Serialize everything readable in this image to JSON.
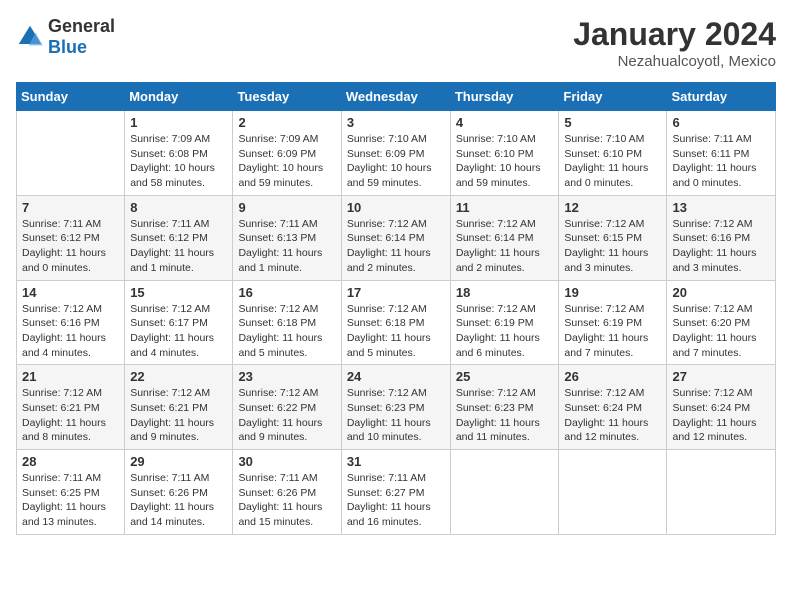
{
  "header": {
    "logo_general": "General",
    "logo_blue": "Blue",
    "month_year": "January 2024",
    "location": "Nezahualcoyotl, Mexico"
  },
  "weekdays": [
    "Sunday",
    "Monday",
    "Tuesday",
    "Wednesday",
    "Thursday",
    "Friday",
    "Saturday"
  ],
  "weeks": [
    [
      {
        "day": "",
        "sunrise": "",
        "sunset": "",
        "daylight": ""
      },
      {
        "day": "1",
        "sunrise": "Sunrise: 7:09 AM",
        "sunset": "Sunset: 6:08 PM",
        "daylight": "Daylight: 10 hours and 58 minutes."
      },
      {
        "day": "2",
        "sunrise": "Sunrise: 7:09 AM",
        "sunset": "Sunset: 6:09 PM",
        "daylight": "Daylight: 10 hours and 59 minutes."
      },
      {
        "day": "3",
        "sunrise": "Sunrise: 7:10 AM",
        "sunset": "Sunset: 6:09 PM",
        "daylight": "Daylight: 10 hours and 59 minutes."
      },
      {
        "day": "4",
        "sunrise": "Sunrise: 7:10 AM",
        "sunset": "Sunset: 6:10 PM",
        "daylight": "Daylight: 10 hours and 59 minutes."
      },
      {
        "day": "5",
        "sunrise": "Sunrise: 7:10 AM",
        "sunset": "Sunset: 6:10 PM",
        "daylight": "Daylight: 11 hours and 0 minutes."
      },
      {
        "day": "6",
        "sunrise": "Sunrise: 7:11 AM",
        "sunset": "Sunset: 6:11 PM",
        "daylight": "Daylight: 11 hours and 0 minutes."
      }
    ],
    [
      {
        "day": "7",
        "sunrise": "Sunrise: 7:11 AM",
        "sunset": "Sunset: 6:12 PM",
        "daylight": "Daylight: 11 hours and 0 minutes."
      },
      {
        "day": "8",
        "sunrise": "Sunrise: 7:11 AM",
        "sunset": "Sunset: 6:12 PM",
        "daylight": "Daylight: 11 hours and 1 minute."
      },
      {
        "day": "9",
        "sunrise": "Sunrise: 7:11 AM",
        "sunset": "Sunset: 6:13 PM",
        "daylight": "Daylight: 11 hours and 1 minute."
      },
      {
        "day": "10",
        "sunrise": "Sunrise: 7:12 AM",
        "sunset": "Sunset: 6:14 PM",
        "daylight": "Daylight: 11 hours and 2 minutes."
      },
      {
        "day": "11",
        "sunrise": "Sunrise: 7:12 AM",
        "sunset": "Sunset: 6:14 PM",
        "daylight": "Daylight: 11 hours and 2 minutes."
      },
      {
        "day": "12",
        "sunrise": "Sunrise: 7:12 AM",
        "sunset": "Sunset: 6:15 PM",
        "daylight": "Daylight: 11 hours and 3 minutes."
      },
      {
        "day": "13",
        "sunrise": "Sunrise: 7:12 AM",
        "sunset": "Sunset: 6:16 PM",
        "daylight": "Daylight: 11 hours and 3 minutes."
      }
    ],
    [
      {
        "day": "14",
        "sunrise": "Sunrise: 7:12 AM",
        "sunset": "Sunset: 6:16 PM",
        "daylight": "Daylight: 11 hours and 4 minutes."
      },
      {
        "day": "15",
        "sunrise": "Sunrise: 7:12 AM",
        "sunset": "Sunset: 6:17 PM",
        "daylight": "Daylight: 11 hours and 4 minutes."
      },
      {
        "day": "16",
        "sunrise": "Sunrise: 7:12 AM",
        "sunset": "Sunset: 6:18 PM",
        "daylight": "Daylight: 11 hours and 5 minutes."
      },
      {
        "day": "17",
        "sunrise": "Sunrise: 7:12 AM",
        "sunset": "Sunset: 6:18 PM",
        "daylight": "Daylight: 11 hours and 5 minutes."
      },
      {
        "day": "18",
        "sunrise": "Sunrise: 7:12 AM",
        "sunset": "Sunset: 6:19 PM",
        "daylight": "Daylight: 11 hours and 6 minutes."
      },
      {
        "day": "19",
        "sunrise": "Sunrise: 7:12 AM",
        "sunset": "Sunset: 6:19 PM",
        "daylight": "Daylight: 11 hours and 7 minutes."
      },
      {
        "day": "20",
        "sunrise": "Sunrise: 7:12 AM",
        "sunset": "Sunset: 6:20 PM",
        "daylight": "Daylight: 11 hours and 7 minutes."
      }
    ],
    [
      {
        "day": "21",
        "sunrise": "Sunrise: 7:12 AM",
        "sunset": "Sunset: 6:21 PM",
        "daylight": "Daylight: 11 hours and 8 minutes."
      },
      {
        "day": "22",
        "sunrise": "Sunrise: 7:12 AM",
        "sunset": "Sunset: 6:21 PM",
        "daylight": "Daylight: 11 hours and 9 minutes."
      },
      {
        "day": "23",
        "sunrise": "Sunrise: 7:12 AM",
        "sunset": "Sunset: 6:22 PM",
        "daylight": "Daylight: 11 hours and 9 minutes."
      },
      {
        "day": "24",
        "sunrise": "Sunrise: 7:12 AM",
        "sunset": "Sunset: 6:23 PM",
        "daylight": "Daylight: 11 hours and 10 minutes."
      },
      {
        "day": "25",
        "sunrise": "Sunrise: 7:12 AM",
        "sunset": "Sunset: 6:23 PM",
        "daylight": "Daylight: 11 hours and 11 minutes."
      },
      {
        "day": "26",
        "sunrise": "Sunrise: 7:12 AM",
        "sunset": "Sunset: 6:24 PM",
        "daylight": "Daylight: 11 hours and 12 minutes."
      },
      {
        "day": "27",
        "sunrise": "Sunrise: 7:12 AM",
        "sunset": "Sunset: 6:24 PM",
        "daylight": "Daylight: 11 hours and 12 minutes."
      }
    ],
    [
      {
        "day": "28",
        "sunrise": "Sunrise: 7:11 AM",
        "sunset": "Sunset: 6:25 PM",
        "daylight": "Daylight: 11 hours and 13 minutes."
      },
      {
        "day": "29",
        "sunrise": "Sunrise: 7:11 AM",
        "sunset": "Sunset: 6:26 PM",
        "daylight": "Daylight: 11 hours and 14 minutes."
      },
      {
        "day": "30",
        "sunrise": "Sunrise: 7:11 AM",
        "sunset": "Sunset: 6:26 PM",
        "daylight": "Daylight: 11 hours and 15 minutes."
      },
      {
        "day": "31",
        "sunrise": "Sunrise: 7:11 AM",
        "sunset": "Sunset: 6:27 PM",
        "daylight": "Daylight: 11 hours and 16 minutes."
      },
      {
        "day": "",
        "sunrise": "",
        "sunset": "",
        "daylight": ""
      },
      {
        "day": "",
        "sunrise": "",
        "sunset": "",
        "daylight": ""
      },
      {
        "day": "",
        "sunrise": "",
        "sunset": "",
        "daylight": ""
      }
    ]
  ]
}
